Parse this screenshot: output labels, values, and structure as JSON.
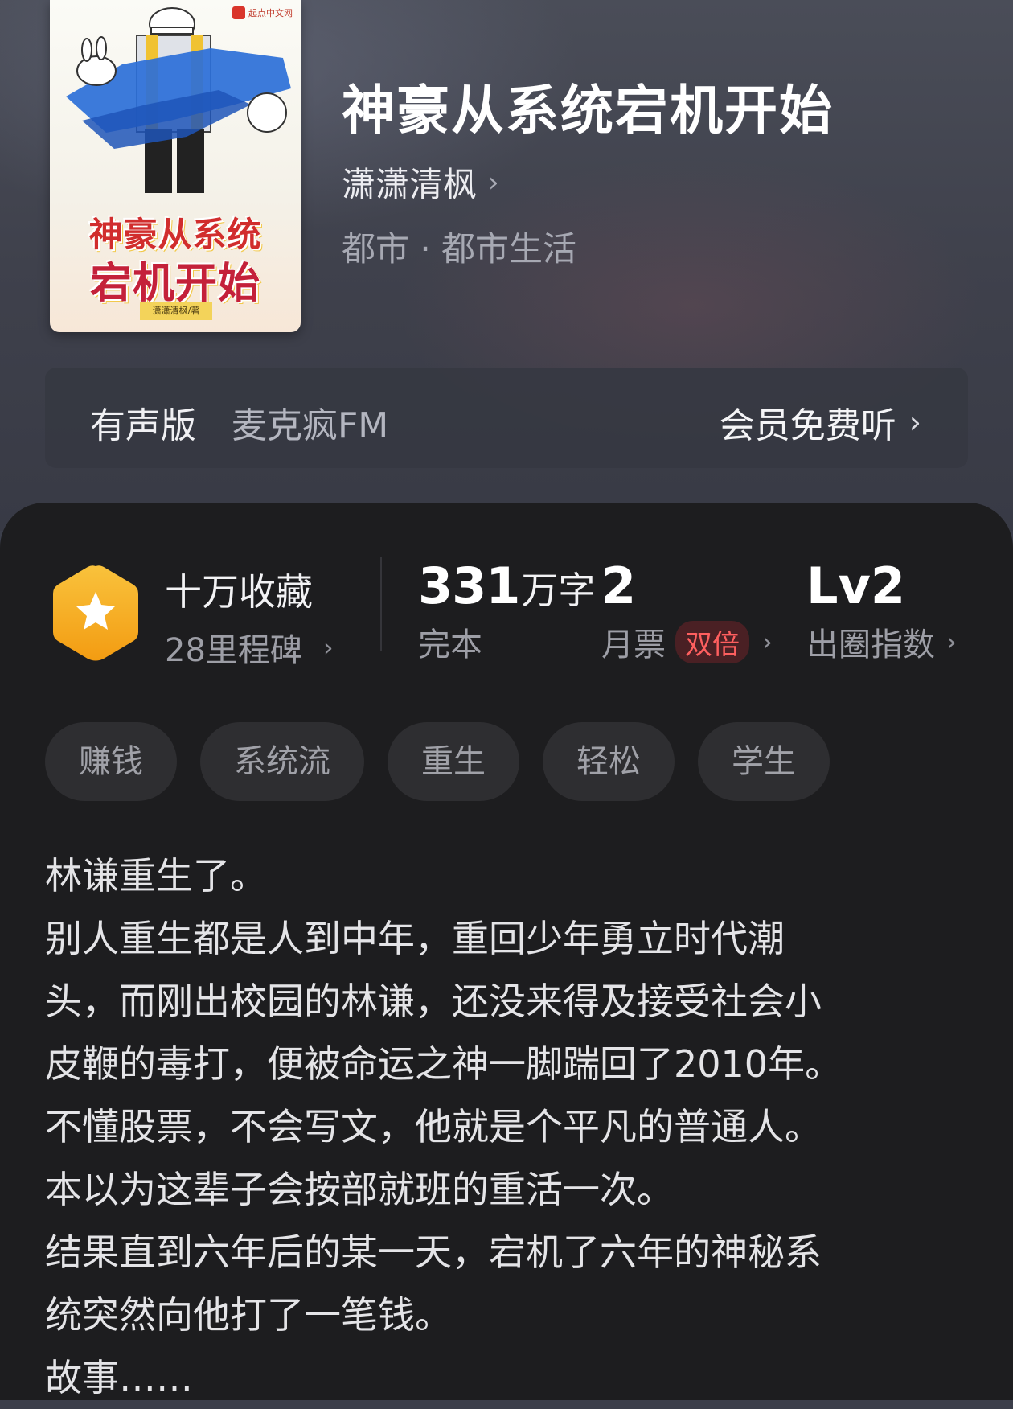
{
  "book": {
    "title": "神豪从系统宕机开始",
    "author": "潇潇清枫",
    "category": "都市 · 都市生活",
    "cover": {
      "brand": "起点中文网",
      "title_line1": "神豪从系统",
      "title_line2": "宕机开始",
      "author_tag": "潇潇清枫/著"
    }
  },
  "audio": {
    "label": "有声版",
    "source": "麦克疯FM",
    "action": "会员免费听"
  },
  "stats": {
    "collection": {
      "title": "十万收藏",
      "sub": "28里程碑"
    },
    "words": {
      "number": "331",
      "unit": "万字",
      "sub": "完本"
    },
    "monthly": {
      "number": "2",
      "sub": "月票",
      "badge": "双倍"
    },
    "level": {
      "number": "Lv2",
      "sub": "出圈指数"
    }
  },
  "tags": [
    "赚钱",
    "系统流",
    "重生",
    "轻松",
    "学生"
  ],
  "description": [
    "林谦重生了。",
    "别人重生都是人到中年，重回少年勇立时代潮",
    "头，而刚出校园的林谦，还没来得及接受社会小",
    "皮鞭的毒打，便被命运之神一脚踹回了2010年。",
    "不懂股票，不会写文，他就是个平凡的普通人。",
    "本以为这辈子会按部就班的重活一次。",
    "结果直到六年后的某一天，宕机了六年的神秘系",
    "统突然向他打了一笔钱。",
    "故事……"
  ],
  "colors": {
    "panel": "#1d1d1f",
    "accent_hex": "#f7b731",
    "badge_red": "#ff5f5f"
  },
  "icons": [
    "star-hexagon-icon",
    "chevron-right-icon"
  ]
}
